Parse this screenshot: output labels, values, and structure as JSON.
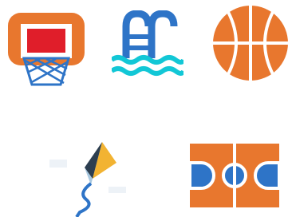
{
  "icons": [
    {
      "name": "basketball-hoop-icon"
    },
    {
      "name": "swimming-pool-icon"
    },
    {
      "name": "basketball-icon"
    },
    {
      "name": "kite-icon"
    },
    {
      "name": "basketball-court-icon"
    }
  ],
  "colors": {
    "orange": "#E8772E",
    "red": "#E01E2A",
    "blue": "#2E74C7",
    "teal": "#12C7D6",
    "white": "#FFFFFF",
    "kite_yellow": "#F2B332",
    "kite_dark": "#2C3E50",
    "kite_light": "#A8C8E0"
  }
}
